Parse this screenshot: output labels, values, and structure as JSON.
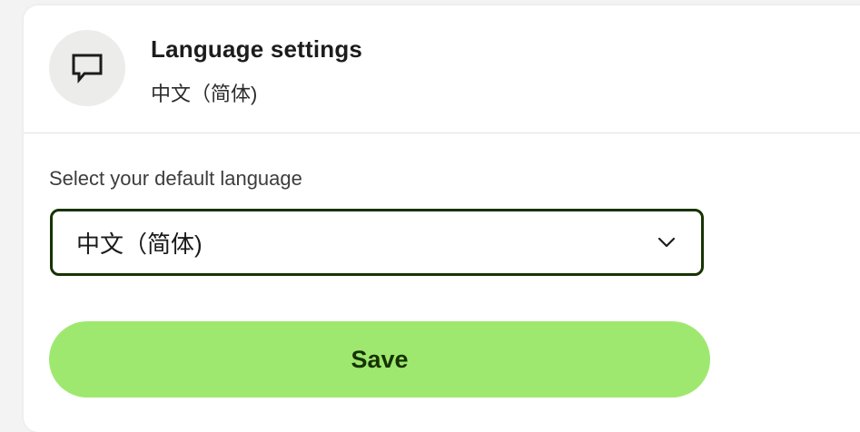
{
  "header": {
    "title": "Language settings",
    "current_language": "中文（简体)",
    "icon": "chat-bubble-icon"
  },
  "form": {
    "label": "Select your default language",
    "selected_language": "中文（简体)",
    "save_label": "Save"
  },
  "colors": {
    "accent": "#9fe870",
    "accent_text": "#163300",
    "select_border": "#163300"
  }
}
